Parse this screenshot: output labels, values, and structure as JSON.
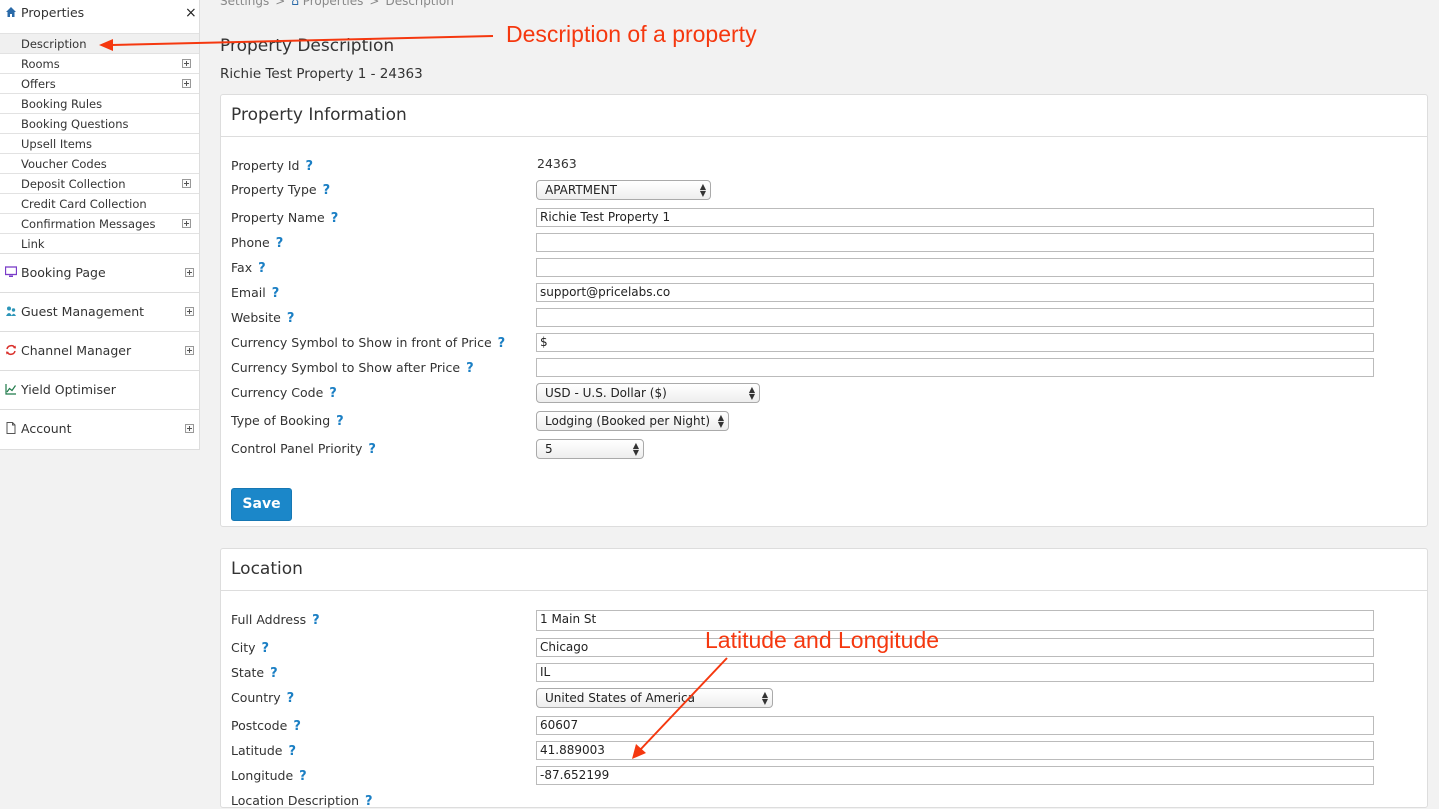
{
  "sidebar": {
    "title": "Properties",
    "close": "×",
    "items": [
      {
        "label": "Description"
      },
      {
        "label": "Rooms"
      },
      {
        "label": "Offers"
      },
      {
        "label": "Booking Rules"
      },
      {
        "label": "Booking Questions"
      },
      {
        "label": "Upsell Items"
      },
      {
        "label": "Voucher Codes"
      },
      {
        "label": "Deposit Collection"
      },
      {
        "label": "Credit Card Collection"
      },
      {
        "label": "Confirmation Messages"
      },
      {
        "label": "Link"
      }
    ],
    "sections": [
      {
        "label": "Booking Page",
        "icon": "monitor-icon"
      },
      {
        "label": "Guest Management",
        "icon": "guests-icon"
      },
      {
        "label": "Channel Manager",
        "icon": "sync-icon"
      },
      {
        "label": "Yield Optimiser",
        "icon": "chart-icon"
      },
      {
        "label": "Account",
        "icon": "document-icon"
      }
    ]
  },
  "breadcrumb": {
    "settings": "Settings",
    "properties": "Properties",
    "description": "Description",
    "separator": ">"
  },
  "page": {
    "title": "Property Description",
    "subtitle": "Richie Test Property 1 - 24363"
  },
  "property_info": {
    "heading": "Property Information",
    "help": "?",
    "fields": {
      "property_id": {
        "label": "Property Id",
        "value": "24363"
      },
      "property_type": {
        "label": "Property Type",
        "value": "APARTMENT"
      },
      "property_name": {
        "label": "Property Name",
        "value": "Richie Test Property 1"
      },
      "phone": {
        "label": "Phone",
        "value": ""
      },
      "fax": {
        "label": "Fax",
        "value": ""
      },
      "email": {
        "label": "Email",
        "value": "support@pricelabs.co"
      },
      "website": {
        "label": "Website",
        "value": ""
      },
      "currency_front": {
        "label": "Currency Symbol to Show in front of Price",
        "value": "$"
      },
      "currency_after": {
        "label": "Currency Symbol to Show after Price",
        "value": ""
      },
      "currency_code": {
        "label": "Currency Code",
        "value": "USD - U.S. Dollar ($)"
      },
      "type_of_booking": {
        "label": "Type of Booking",
        "value": "Lodging (Booked per Night)"
      },
      "control_panel_priority": {
        "label": "Control Panel Priority",
        "value": "5"
      }
    },
    "save_label": "Save"
  },
  "location": {
    "heading": "Location",
    "fields": {
      "full_address": {
        "label": "Full Address",
        "value": "1 Main St"
      },
      "city": {
        "label": "City",
        "value": "Chicago"
      },
      "state": {
        "label": "State",
        "value": "IL"
      },
      "country": {
        "label": "Country",
        "value": "United States of America"
      },
      "postcode": {
        "label": "Postcode",
        "value": "60607"
      },
      "latitude": {
        "label": "Latitude",
        "value": "41.889003"
      },
      "longitude": {
        "label": "Longitude",
        "value": "-87.652199"
      },
      "location_description": {
        "label": "Location Description"
      }
    }
  },
  "annotations": {
    "description_note": "Description of a property",
    "latlng_note": "Latitude and Longitude",
    "color": "#f5380f"
  },
  "colors": {
    "accent": "#1b87c9",
    "help": "#1b7fc4"
  }
}
